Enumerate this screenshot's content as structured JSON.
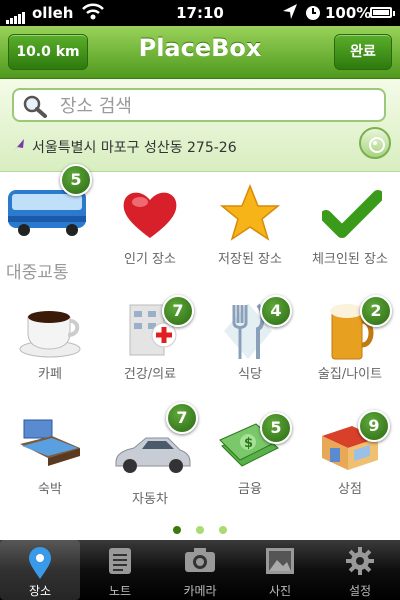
{
  "status": {
    "carrier": "olleh",
    "time": "17:10",
    "battery": "100%"
  },
  "nav": {
    "distance_btn": "10.0 km",
    "title": "PlaceBox",
    "done_btn": "완료"
  },
  "search": {
    "placeholder": "장소 검색"
  },
  "location": {
    "address": "서울특별시 마포구 성산동 275-26"
  },
  "categories": [
    {
      "label": "대중교통",
      "badge": "5",
      "icon": "bus-icon"
    },
    {
      "label": "인기 장소",
      "badge": "",
      "icon": "heart-icon"
    },
    {
      "label": "저장된 장소",
      "badge": "",
      "icon": "star-icon"
    },
    {
      "label": "체크인된 장소",
      "badge": "",
      "icon": "checkmark-icon"
    },
    {
      "label": "카페",
      "badge": "",
      "icon": "coffee-cup-icon"
    },
    {
      "label": "건강/의료",
      "badge": "7",
      "icon": "hospital-icon"
    },
    {
      "label": "식당",
      "badge": "4",
      "icon": "fork-knife-icon"
    },
    {
      "label": "술집/나이트",
      "badge": "2",
      "icon": "beer-mug-icon"
    },
    {
      "label": "숙박",
      "badge": "",
      "icon": "bed-icon"
    },
    {
      "label": "자동차",
      "badge": "7",
      "icon": "car-icon"
    },
    {
      "label": "금융",
      "badge": "5",
      "icon": "money-icon"
    },
    {
      "label": "상점",
      "badge": "9",
      "icon": "shop-icon"
    }
  ],
  "page_indicator": {
    "count": 3,
    "active": 1
  },
  "tabs": [
    {
      "label": "장소",
      "icon": "location-pin-icon",
      "active": true
    },
    {
      "label": "노트",
      "icon": "notes-icon",
      "active": false
    },
    {
      "label": "카메라",
      "icon": "camera-icon",
      "active": false
    },
    {
      "label": "사진",
      "icon": "photo-icon",
      "active": false
    },
    {
      "label": "설정",
      "icon": "gear-icon",
      "active": false
    }
  ],
  "colors": {
    "accent": "#5aae2a",
    "badge": "#3a8a1e",
    "tabbar": "#000000"
  }
}
